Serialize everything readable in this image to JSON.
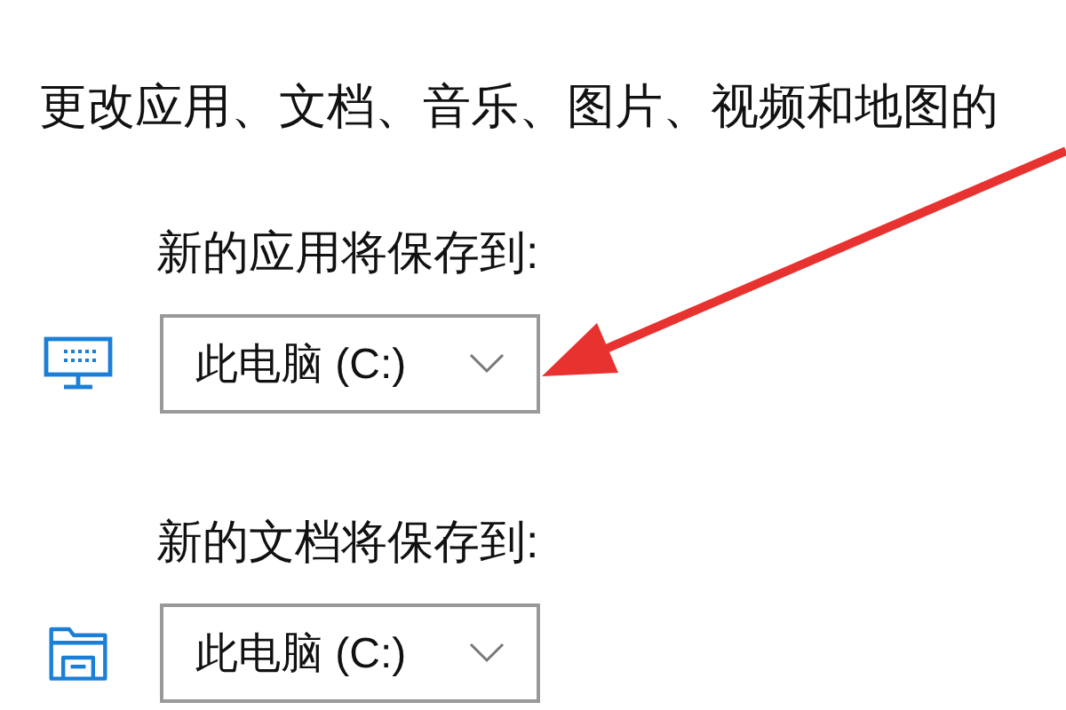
{
  "description": "更改应用、文档、音乐、图片、视频和地图的",
  "sections": [
    {
      "label": "新的应用将保存到:",
      "kind": "apps",
      "value": "此电脑 (C:)"
    },
    {
      "label": "新的文档将保存到:",
      "kind": "documents",
      "value": "此电脑 (C:)"
    }
  ]
}
